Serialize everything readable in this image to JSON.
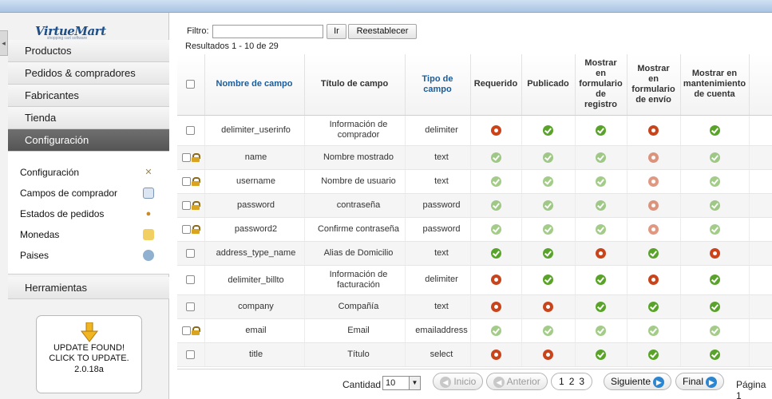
{
  "sidebar": {
    "logo": "VirtueMart",
    "logo_tagline": "shopping cart software",
    "menu": [
      {
        "label": "Productos"
      },
      {
        "label": "Pedidos & compradores"
      },
      {
        "label": "Fabricantes"
      },
      {
        "label": "Tienda"
      },
      {
        "label": "Configuración"
      }
    ],
    "submenu": [
      {
        "label": "Configuración",
        "icon": "tools-icon"
      },
      {
        "label": "Campos de comprador",
        "icon": "user-fields-icon"
      },
      {
        "label": "Estados de pedidos",
        "icon": "order-status-icon"
      },
      {
        "label": "Monedas",
        "icon": "coins-icon"
      },
      {
        "label": "Paises",
        "icon": "globe-icon"
      }
    ],
    "tools": "Herramientas",
    "update": {
      "line1": "UPDATE FOUND!",
      "line2": "CLICK TO UPDATE.",
      "version": "2.0.18a"
    }
  },
  "filter": {
    "label": "Filtro:",
    "value": "",
    "go": "Ir",
    "reset": "Reestablecer"
  },
  "results": "Resultados 1 - 10 de 29",
  "table": {
    "headers": {
      "name": "Nombre de campo",
      "title": "Título de campo",
      "type_l1": "Tipo de",
      "type_l2": "campo",
      "required": "Requerido",
      "published": "Publicado",
      "reg_l1": "Mostrar",
      "reg_l2": "en",
      "reg_l3": "formulario",
      "reg_l4": "de",
      "reg_l5": "registro",
      "ship_l1": "Mostrar",
      "ship_l2": "en",
      "ship_l3": "formulario",
      "ship_l4": "de envío",
      "acct_l1": "Mostrar en",
      "acct_l2": "mantenimiento",
      "acct_l3": "de cuenta"
    },
    "rows": [
      {
        "name": "delimiter_userinfo",
        "title_l1": "Información de",
        "title_l2": "comprador",
        "type": "delimiter",
        "locked": false
      },
      {
        "name": "name",
        "title_l1": "Nombre mostrado",
        "title_l2": "",
        "type": "text",
        "locked": true
      },
      {
        "name": "username",
        "title_l1": "Nombre de usuario",
        "title_l2": "",
        "type": "text",
        "locked": true
      },
      {
        "name": "password",
        "title_l1": "contraseña",
        "title_l2": "",
        "type": "password",
        "locked": true
      },
      {
        "name": "password2",
        "title_l1": "Confirme contraseña",
        "title_l2": "",
        "type": "password",
        "locked": true
      },
      {
        "name": "address_type_name",
        "title_l1": "Alias de Domicilio",
        "title_l2": "",
        "type": "text",
        "locked": false
      },
      {
        "name": "delimiter_billto",
        "title_l1": "Información de",
        "title_l2": "facturación",
        "type": "delimiter",
        "locked": false
      },
      {
        "name": "company",
        "title_l1": "Compañía",
        "title_l2": "",
        "type": "text",
        "locked": false
      },
      {
        "name": "email",
        "title_l1": "Email",
        "title_l2": "",
        "type": "emailaddress",
        "locked": true
      },
      {
        "name": "title",
        "title_l1": "Título",
        "title_l2": "",
        "type": "select",
        "locked": false
      }
    ],
    "status": [
      [
        "no",
        "yes",
        "yes",
        "no",
        "yes"
      ],
      [
        "yes-faded",
        "yes-faded",
        "yes-faded",
        "no-faded",
        "yes-faded"
      ],
      [
        "yes-faded",
        "yes-faded",
        "yes-faded",
        "no-faded",
        "yes-faded"
      ],
      [
        "yes-faded",
        "yes-faded",
        "yes-faded",
        "no-faded",
        "yes-faded"
      ],
      [
        "yes-faded",
        "yes-faded",
        "yes-faded",
        "no-faded",
        "yes-faded"
      ],
      [
        "yes",
        "yes",
        "no",
        "yes",
        "no"
      ],
      [
        "no",
        "yes",
        "yes",
        "no",
        "yes"
      ],
      [
        "no",
        "no",
        "yes",
        "yes",
        "yes"
      ],
      [
        "yes-faded",
        "yes-faded",
        "yes-faded",
        "yes-faded",
        "yes-faded"
      ],
      [
        "no",
        "no",
        "yes",
        "yes",
        "yes"
      ]
    ]
  },
  "pager": {
    "quantity_label": "Cantidad",
    "quantity_value": "10",
    "first": "Inicio",
    "prev": "Anterior",
    "pages": [
      "1",
      "2",
      "3"
    ],
    "next": "Siguiente",
    "last": "Final",
    "page_info": "Página 1"
  }
}
